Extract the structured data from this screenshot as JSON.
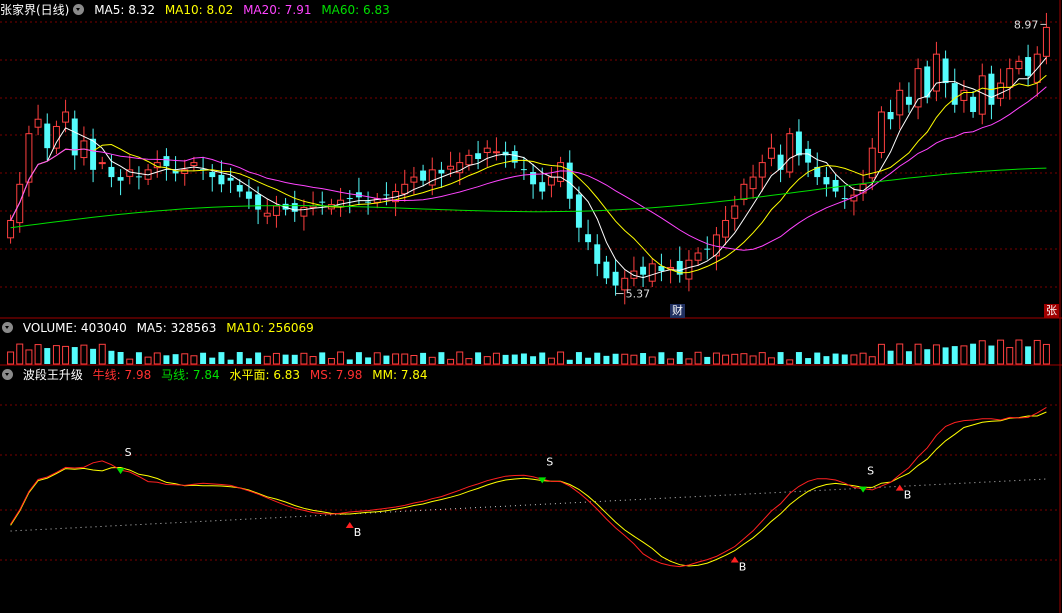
{
  "header": {
    "stock_title": "张家界(日线)",
    "ma5": "MA5: 8.32",
    "ma10": "MA10: 8.02",
    "ma20": "MA20: 7.91",
    "ma60": "MA60: 6.83"
  },
  "volume_header": {
    "volume": "VOLUME: 403040",
    "ma5": "MA5: 328563",
    "ma10": "MA10: 256069"
  },
  "indicator_header": {
    "name": "波段王升级",
    "bull": "牛线: 7.98",
    "horse": "马线: 7.84",
    "level": "水平面: 6.83",
    "ms": "MS: 7.98",
    "mm": "MM: 7.84"
  },
  "badges": {
    "cai": "财",
    "zhang": "张"
  },
  "colors": {
    "up": "#ff4040",
    "down": "#54fcfc",
    "ma5": "#ffffff",
    "ma10": "#ffff00",
    "ma20": "#ff44ff",
    "ma60": "#00e000",
    "grid": "#7a0000"
  },
  "chart_data": [
    {
      "type": "candlestick",
      "y_range": [
        5.2,
        9.1
      ],
      "annotations": [
        {
          "label": "8.97",
          "at": "high"
        },
        {
          "label": "5.37",
          "at": "low"
        }
      ],
      "close": [
        6.3,
        6.8,
        7.5,
        7.7,
        7.3,
        7.6,
        7.8,
        7.2,
        7.4,
        7.0,
        7.1,
        6.9,
        6.85,
        7.0,
        6.9,
        7.0,
        7.1,
        7.05,
        6.95,
        7.0,
        7.1,
        7.0,
        6.9,
        6.8,
        6.85,
        6.7,
        6.6,
        6.45,
        6.4,
        6.5,
        6.45,
        6.42,
        6.48,
        6.5,
        6.55,
        6.52,
        6.58,
        6.6,
        6.62,
        6.55,
        6.6,
        6.65,
        6.7,
        6.8,
        6.9,
        6.85,
        7.0,
        6.95,
        7.05,
        7.1,
        7.2,
        7.15,
        7.3,
        7.25,
        7.2,
        7.1,
        7.0,
        6.8,
        6.7,
        6.9,
        7.1,
        6.6,
        6.2,
        6.0,
        5.7,
        5.5,
        5.4,
        5.5,
        5.6,
        5.55,
        5.7,
        5.6,
        5.65,
        5.55,
        5.75,
        5.85,
        5.9,
        6.1,
        6.3,
        6.5,
        6.8,
        6.9,
        7.1,
        7.3,
        7.0,
        7.5,
        7.2,
        7.1,
        6.9,
        6.8,
        6.7,
        6.6,
        6.65,
        6.8,
        7.3,
        7.8,
        7.7,
        8.1,
        7.9,
        8.4,
        8.0,
        8.6,
        8.2,
        7.9,
        8.1,
        7.8,
        8.3,
        7.9,
        8.2,
        8.4,
        8.5,
        8.3,
        8.6,
        8.97
      ],
      "ma5_at_last": 8.32,
      "ma10_at_last": 8.02,
      "ma20_at_last": 7.91,
      "ma60_at_last": 6.83
    },
    {
      "type": "bar",
      "title": "VOLUME",
      "last_value": 403040,
      "ma5": 328563,
      "ma10": 256069
    },
    {
      "type": "line",
      "title": "波段王升级",
      "series": [
        {
          "name": "牛线",
          "last": 7.98
        },
        {
          "name": "马线",
          "last": 7.84
        },
        {
          "name": "水平面",
          "last": 6.83
        }
      ],
      "signals": [
        "S",
        "B",
        "S",
        "B",
        "S",
        "B"
      ]
    }
  ]
}
